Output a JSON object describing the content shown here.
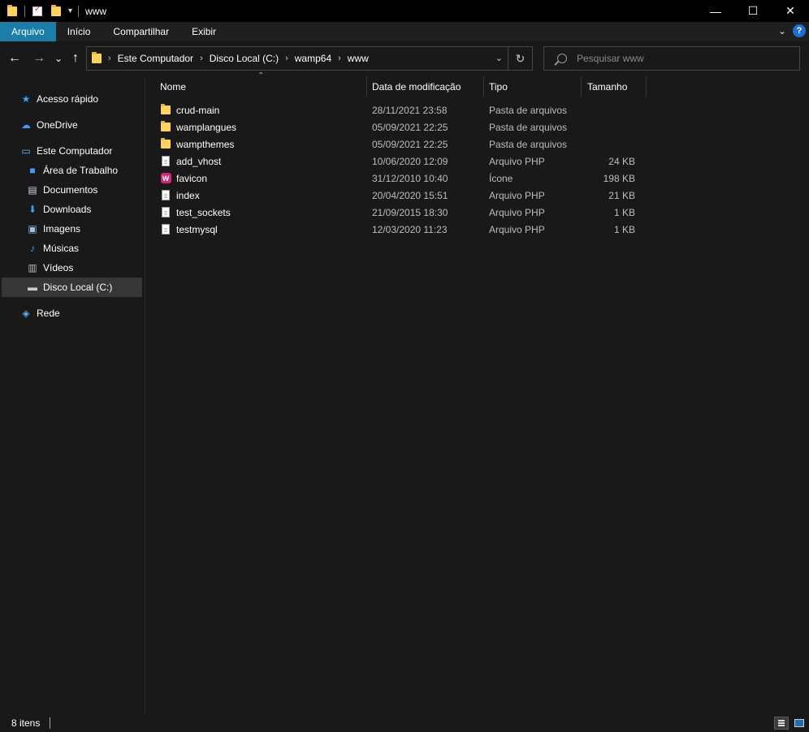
{
  "window": {
    "title": "www",
    "minimize": "—",
    "maximize": "☐",
    "close": "✕"
  },
  "ribbon": {
    "tabs": [
      "Arquivo",
      "Início",
      "Compartilhar",
      "Exibir"
    ],
    "help": "?"
  },
  "nav": {
    "back": "←",
    "forward": "→",
    "recent": "⌄",
    "up": "↑"
  },
  "address": {
    "crumbs": [
      "Este Computador",
      "Disco Local (C:)",
      "wamp64",
      "www"
    ]
  },
  "search": {
    "placeholder": "Pesquisar www"
  },
  "sidebar": {
    "items": [
      {
        "label": "Acesso rápido",
        "icon": "star-icon"
      },
      {
        "label": "OneDrive",
        "icon": "cloud-icon"
      },
      {
        "label": "Este Computador",
        "icon": "computer-icon"
      },
      {
        "label": "Área de Trabalho",
        "icon": "desktop-icon"
      },
      {
        "label": "Documentos",
        "icon": "document-icon"
      },
      {
        "label": "Downloads",
        "icon": "download-icon"
      },
      {
        "label": "Imagens",
        "icon": "image-icon"
      },
      {
        "label": "Músicas",
        "icon": "music-icon"
      },
      {
        "label": "Vídeos",
        "icon": "video-icon"
      },
      {
        "label": "Disco Local (C:)",
        "icon": "drive-icon"
      },
      {
        "label": "Rede",
        "icon": "network-icon"
      }
    ]
  },
  "columns": {
    "name": "Nome",
    "date": "Data de modificação",
    "type": "Tipo",
    "size": "Tamanho"
  },
  "files": [
    {
      "name": "crud-main",
      "date": "28/11/2021 23:58",
      "type": "Pasta de arquivos",
      "size": "",
      "icon": "folder-icon"
    },
    {
      "name": "wamplangues",
      "date": "05/09/2021 22:25",
      "type": "Pasta de arquivos",
      "size": "",
      "icon": "folder-icon"
    },
    {
      "name": "wampthemes",
      "date": "05/09/2021 22:25",
      "type": "Pasta de arquivos",
      "size": "",
      "icon": "folder-icon"
    },
    {
      "name": "add_vhost",
      "date": "10/06/2020 12:09",
      "type": "Arquivo PHP",
      "size": "24 KB",
      "icon": "php-file-icon"
    },
    {
      "name": "favicon",
      "date": "31/12/2010 10:40",
      "type": "Ícone",
      "size": "198 KB",
      "icon": "favicon-icon"
    },
    {
      "name": "index",
      "date": "20/04/2020 15:51",
      "type": "Arquivo PHP",
      "size": "21 KB",
      "icon": "php-file-icon"
    },
    {
      "name": "test_sockets",
      "date": "21/09/2015 18:30",
      "type": "Arquivo PHP",
      "size": "1 KB",
      "icon": "php-file-icon"
    },
    {
      "name": "testmysql",
      "date": "12/03/2020 11:23",
      "type": "Arquivo PHP",
      "size": "1 KB",
      "icon": "php-file-icon"
    }
  ],
  "status": {
    "count": "8 itens"
  }
}
